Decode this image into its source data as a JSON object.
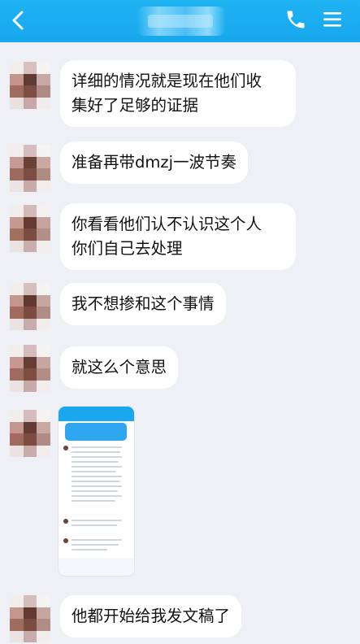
{
  "messages": [
    {
      "id": "m1",
      "text": "详细的情况就是现在他们收\n集好了足够的证据"
    },
    {
      "id": "m2",
      "text": "准备再带dmzj一波节奏"
    },
    {
      "id": "m3",
      "text": "你看看他们认不认识这个人\n你们自己去处理"
    },
    {
      "id": "m4",
      "text": "我不想掺和这个事情"
    },
    {
      "id": "m5",
      "text": "就这么个意思"
    },
    {
      "id": "m7",
      "text": "他都开始给我发文稿了"
    }
  ],
  "colors": {
    "header": "#17a7ee",
    "background": "#eef0f5",
    "bubble": "#ffffff"
  },
  "icons": {
    "back": "chevron-left-icon",
    "call": "phone-icon",
    "menu": "hamburger-menu-icon"
  }
}
